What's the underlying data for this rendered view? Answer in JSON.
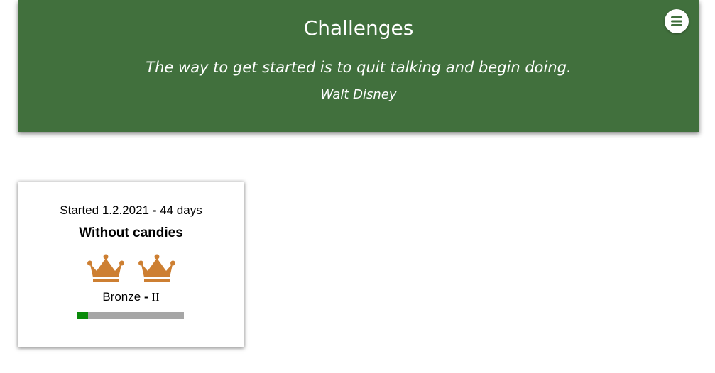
{
  "header": {
    "title": "Challenges",
    "quote": "The way to get started is to quit talking and begin doing.",
    "author": "Walt Disney",
    "menu_icon": "hamburger-menu-icon",
    "background_color": "#41703d"
  },
  "challenges": [
    {
      "started_prefix": "Started",
      "start_date": "1.2.2021",
      "separator": "-",
      "duration": "44 days",
      "name": "Without candies",
      "crown_icon": "crown-icon",
      "crown_count": 2,
      "crown_color": "#cd7f32",
      "rank": "Bronze",
      "rank_separator": "-",
      "rank_level": "II",
      "progress_fraction": 0.1,
      "progress_color": "#0a8a0a",
      "progress_track_color": "#a6a6a6"
    }
  ]
}
